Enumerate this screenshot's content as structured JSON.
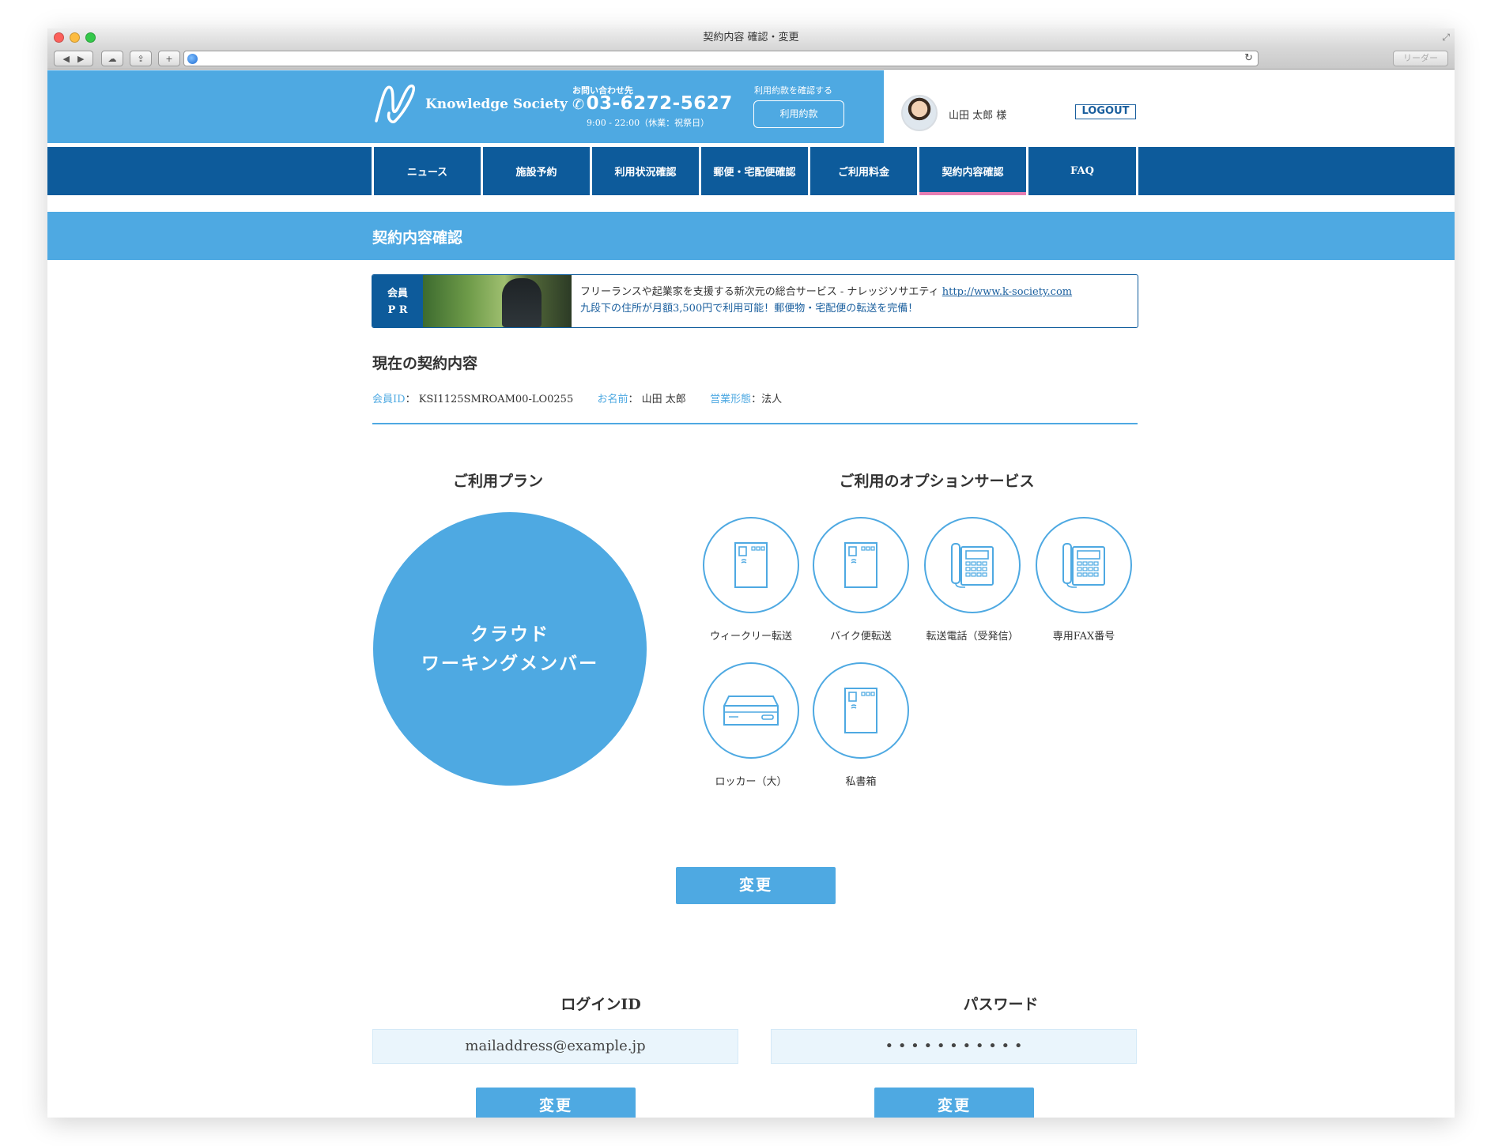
{
  "browser": {
    "title": "契約内容 確認・変更",
    "reader_label": "リーダー"
  },
  "header": {
    "logo_text": "Knowledge Society",
    "contact_label": "お問い合わせ先",
    "phone": "03-6272-5627",
    "hours": "9:00 - 22:00（休業：祝祭日）",
    "terms_label": "利用約款を確認する",
    "terms_button": "利用約款",
    "username": "山田 太郎 様",
    "logout": "LOGOUT"
  },
  "nav": {
    "items": [
      {
        "label": "ニュース"
      },
      {
        "label": "施設予約"
      },
      {
        "label": "利用状況確認"
      },
      {
        "label": "郵便・宅配便確認"
      },
      {
        "label": "ご利用料金"
      },
      {
        "label": "契約内容確認"
      },
      {
        "label": "FAQ"
      }
    ],
    "active_index": 5
  },
  "page_title": "契約内容確認",
  "pr": {
    "label_line1": "会員",
    "label_line2": "P R",
    "line1": "フリーランスや起業家を支援する新次元の総合サービス - ナレッジソサエティ",
    "link": "http://www.k-society.com",
    "line2": "九段下の住所が月額3,500円で利用可能！郵便物・宅配便の転送を完備！"
  },
  "current": {
    "heading": "現在の契約内容",
    "member_id_label": "会員ID",
    "member_id": "KSI1125SMROAM00-LO0255",
    "name_label": "お名前",
    "name": "山田 太郎",
    "business_label": "営業形態",
    "business": "法人"
  },
  "plan": {
    "heading": "ご利用プラン",
    "line1": "クラウド",
    "line2": "ワーキングメンバー"
  },
  "options": {
    "heading": "ご利用のオプションサービス",
    "items": [
      {
        "label": "ウィークリー転送",
        "icon": "envelope-icon"
      },
      {
        "label": "バイク便転送",
        "icon": "envelope-icon"
      },
      {
        "label": "転送電話（受発信）",
        "icon": "phone-icon"
      },
      {
        "label": "専用FAX番号",
        "icon": "phone-icon"
      },
      {
        "label": "ロッカー（大）",
        "icon": "locker-icon"
      },
      {
        "label": "私書箱",
        "icon": "envelope-icon"
      }
    ]
  },
  "change_label": "変更",
  "login": {
    "id_label": "ログインID",
    "id_value": "mailaddress@example.jp",
    "password_label": "パスワード",
    "password_value": "• • • • • • • • • • •"
  },
  "colors": {
    "accent": "#4ea9e2",
    "nav": "#0d5b9b",
    "active_underline": "#e77eb3"
  }
}
